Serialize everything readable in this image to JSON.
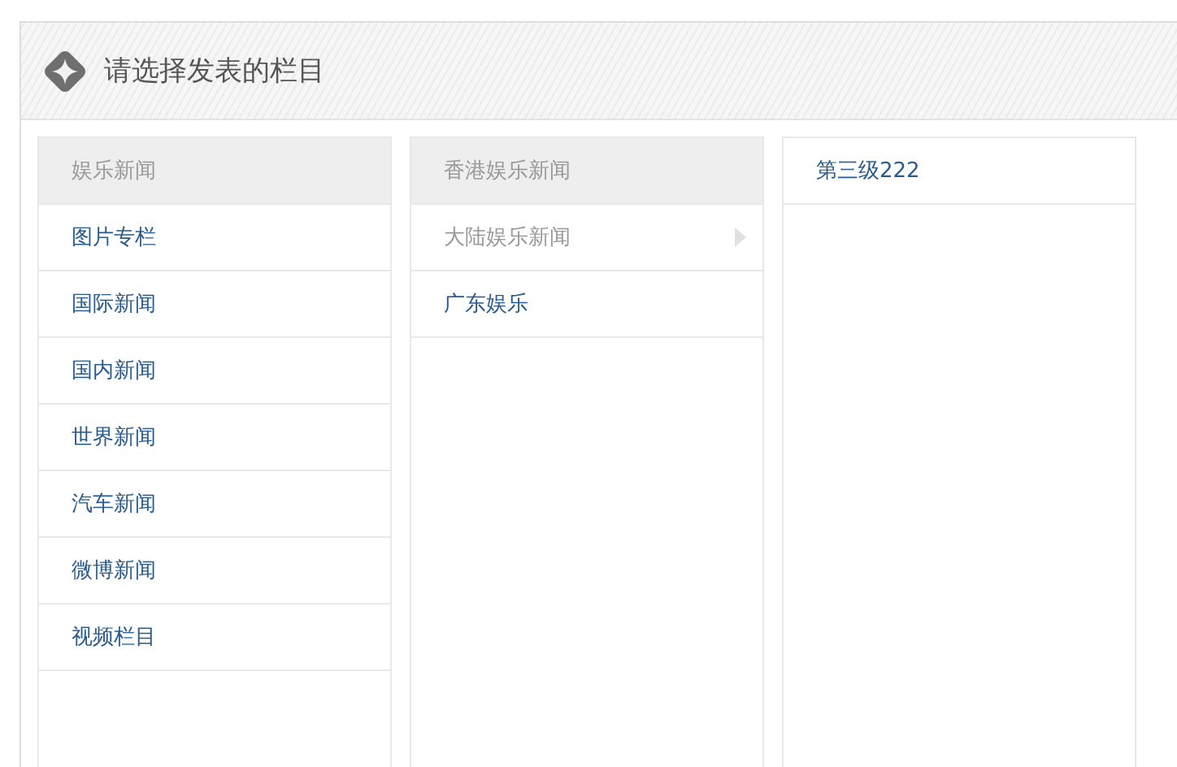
{
  "header": {
    "title": "请选择发表的栏目"
  },
  "columns": [
    {
      "items": [
        {
          "label": "娱乐新闻",
          "selected": true,
          "dimmed": true,
          "has_children": false
        },
        {
          "label": "图片专栏",
          "selected": false,
          "dimmed": false,
          "has_children": false
        },
        {
          "label": "国际新闻",
          "selected": false,
          "dimmed": false,
          "has_children": false
        },
        {
          "label": "国内新闻",
          "selected": false,
          "dimmed": false,
          "has_children": false
        },
        {
          "label": "世界新闻",
          "selected": false,
          "dimmed": false,
          "has_children": false
        },
        {
          "label": "汽车新闻",
          "selected": false,
          "dimmed": false,
          "has_children": false
        },
        {
          "label": "微博新闻",
          "selected": false,
          "dimmed": false,
          "has_children": false
        },
        {
          "label": "视频栏目",
          "selected": false,
          "dimmed": false,
          "has_children": false
        }
      ]
    },
    {
      "items": [
        {
          "label": "香港娱乐新闻",
          "selected": true,
          "dimmed": true,
          "has_children": false
        },
        {
          "label": "大陆娱乐新闻",
          "selected": false,
          "dimmed": true,
          "has_children": true
        },
        {
          "label": "广东娱乐",
          "selected": false,
          "dimmed": false,
          "has_children": false
        }
      ]
    },
    {
      "items": [
        {
          "label": "第三级222",
          "selected": false,
          "dimmed": false,
          "has_children": false
        }
      ]
    }
  ]
}
